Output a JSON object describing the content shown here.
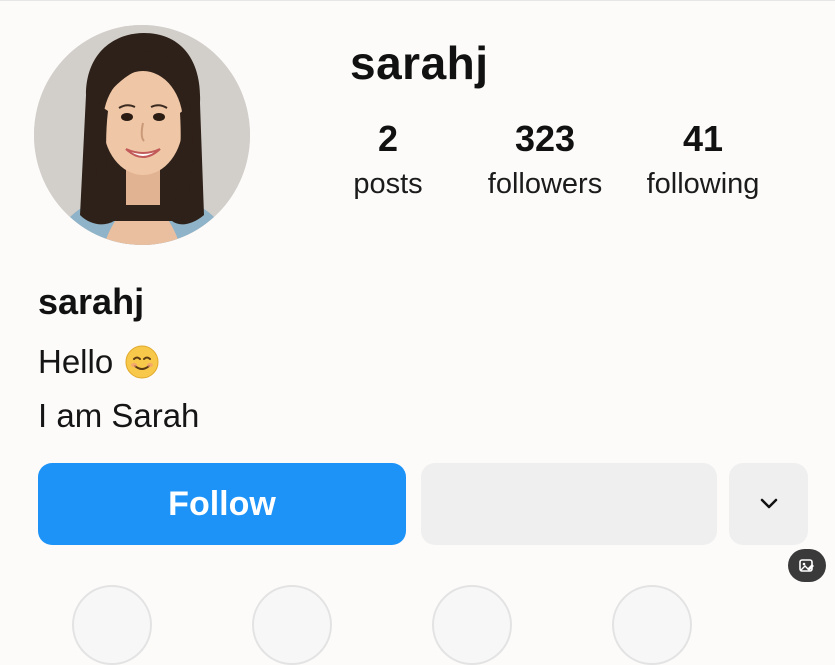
{
  "profile": {
    "username": "sarahj",
    "display_name": "sarahj",
    "bio_line_1": "Hello",
    "bio_emoji": "smiling-face-emoji",
    "bio_line_2": "I am Sarah",
    "avatar_icon": "profile-photo"
  },
  "stats": {
    "posts": {
      "value": "2",
      "label": "posts"
    },
    "followers": {
      "value": "323",
      "label": "followers"
    },
    "following": {
      "value": "41",
      "label": "following"
    }
  },
  "actions": {
    "follow_label": "Follow",
    "more_icon": "chevron-down-icon"
  },
  "colors": {
    "follow_button": "#1d93f7",
    "secondary_button": "#efefef",
    "background": "#fcfbfa"
  }
}
